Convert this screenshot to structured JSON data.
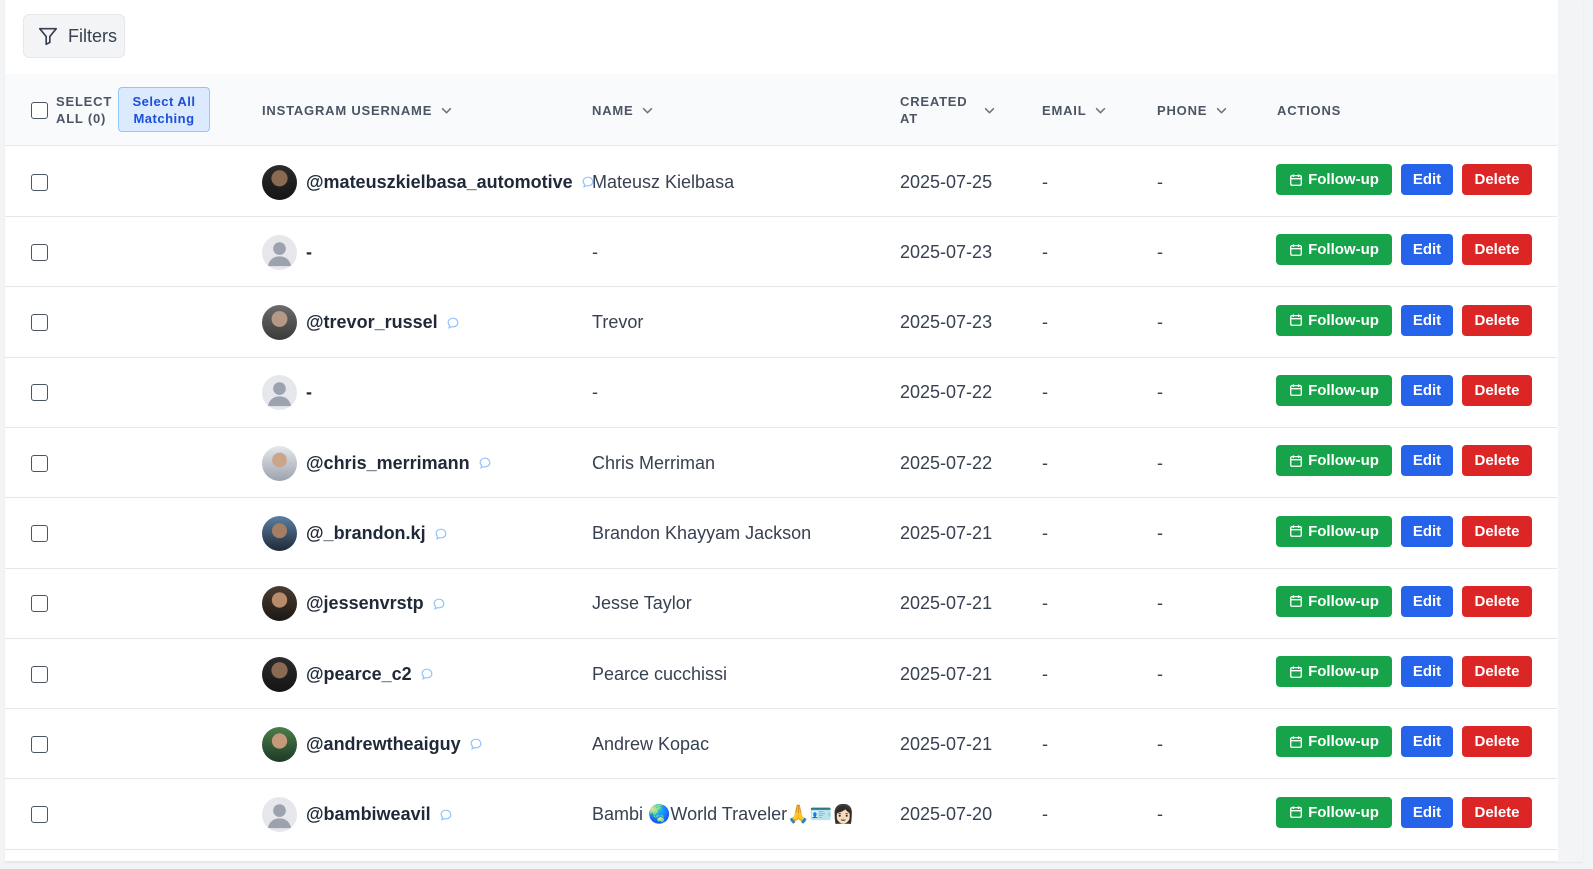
{
  "toolbar": {
    "filters_label": "Filters"
  },
  "header": {
    "select_all_line1": "SELECT",
    "select_all_line2": "ALL (0)",
    "select_all_matching_line1": "Select All",
    "select_all_matching_line2": "Matching",
    "col_username": "INSTAGRAM USERNAME",
    "col_name": "NAME",
    "col_created_line1": "CREATED",
    "col_created_line2": "AT",
    "col_email": "EMAIL",
    "col_phone": "PHONE",
    "col_actions": "ACTIONS"
  },
  "actions": {
    "followup": "Follow-up",
    "edit": "Edit",
    "delete": "Delete"
  },
  "rows": [
    {
      "username": "@mateuszkielbasa_automotive",
      "name": "Mateusz Kielbasa",
      "created": "2025-07-25",
      "email": "-",
      "phone": "-",
      "avatar": "photo-dark",
      "has_chat": true
    },
    {
      "username": "-",
      "name": "-",
      "created": "2025-07-23",
      "email": "-",
      "phone": "-",
      "avatar": "default-user",
      "has_chat": false
    },
    {
      "username": "@trevor_russel",
      "name": "Trevor",
      "created": "2025-07-23",
      "email": "-",
      "phone": "-",
      "avatar": "photo-grey",
      "has_chat": true
    },
    {
      "username": "-",
      "name": "-",
      "created": "2025-07-22",
      "email": "-",
      "phone": "-",
      "avatar": "default-user",
      "has_chat": false
    },
    {
      "username": "@chris_merrimann",
      "name": "Chris Merriman",
      "created": "2025-07-22",
      "email": "-",
      "phone": "-",
      "avatar": "photo-light",
      "has_chat": true
    },
    {
      "username": "@_brandon.kj",
      "name": "Brandon Khayyam Jackson",
      "created": "2025-07-21",
      "email": "-",
      "phone": "-",
      "avatar": "photo-blue",
      "has_chat": true
    },
    {
      "username": "@jessenvrstp",
      "name": "Jesse Taylor",
      "created": "2025-07-21",
      "email": "-",
      "phone": "-",
      "avatar": "photo-brown",
      "has_chat": true
    },
    {
      "username": "@pearce_c2",
      "name": "Pearce cucchissi",
      "created": "2025-07-21",
      "email": "-",
      "phone": "-",
      "avatar": "photo-dark",
      "has_chat": true
    },
    {
      "username": "@andrewtheaiguy",
      "name": "Andrew Kopac",
      "created": "2025-07-21",
      "email": "-",
      "phone": "-",
      "avatar": "photo-green",
      "has_chat": true
    },
    {
      "username": "@bambiweavil",
      "name": "Bambi 🌏World Traveler🙏🪪👩🏻",
      "created": "2025-07-20",
      "email": "-",
      "phone": "-",
      "avatar": "default-user",
      "has_chat": true
    }
  ]
}
